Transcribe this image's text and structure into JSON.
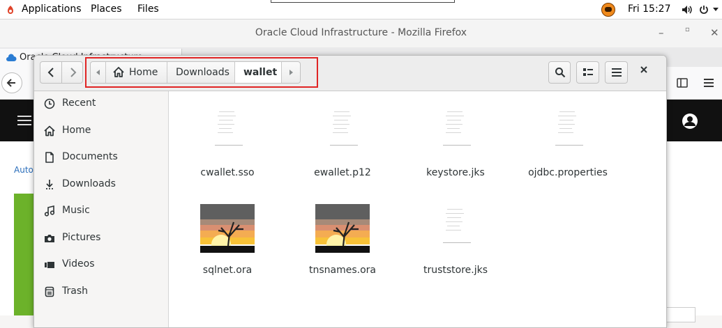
{
  "topbar": {
    "applications": "Applications",
    "places": "Places",
    "files": "Files",
    "clock": "Fri 15:27"
  },
  "firefox": {
    "window_title": "Oracle Cloud Infrastructure - Mozilla Firefox",
    "tab_title": "Oracle Cloud Infrastructure",
    "page_link_text": "Auton"
  },
  "nautilus": {
    "path": [
      {
        "label": "Home"
      },
      {
        "label": "Downloads"
      },
      {
        "label": "wallet"
      }
    ],
    "sidebar": [
      {
        "label": "Recent",
        "icon": "clock-icon"
      },
      {
        "label": "Home",
        "icon": "home-icon"
      },
      {
        "label": "Documents",
        "icon": "document-icon"
      },
      {
        "label": "Downloads",
        "icon": "download-icon"
      },
      {
        "label": "Music",
        "icon": "music-icon"
      },
      {
        "label": "Pictures",
        "icon": "camera-icon"
      },
      {
        "label": "Videos",
        "icon": "video-icon"
      },
      {
        "label": "Trash",
        "icon": "trash-icon"
      }
    ],
    "files": [
      {
        "name": "cwallet.sso",
        "kind": "document"
      },
      {
        "name": "ewallet.p12",
        "kind": "document"
      },
      {
        "name": "keystore.jks",
        "kind": "document"
      },
      {
        "name": "ojdbc.properties",
        "kind": "document"
      },
      {
        "name": "sqlnet.ora",
        "kind": "image"
      },
      {
        "name": "tnsnames.ora",
        "kind": "image"
      },
      {
        "name": "truststore.jks",
        "kind": "document"
      }
    ]
  },
  "colors": {
    "highlight": "#e02424",
    "accent_green": "#6cb22a",
    "dark_bar": "#111111"
  }
}
